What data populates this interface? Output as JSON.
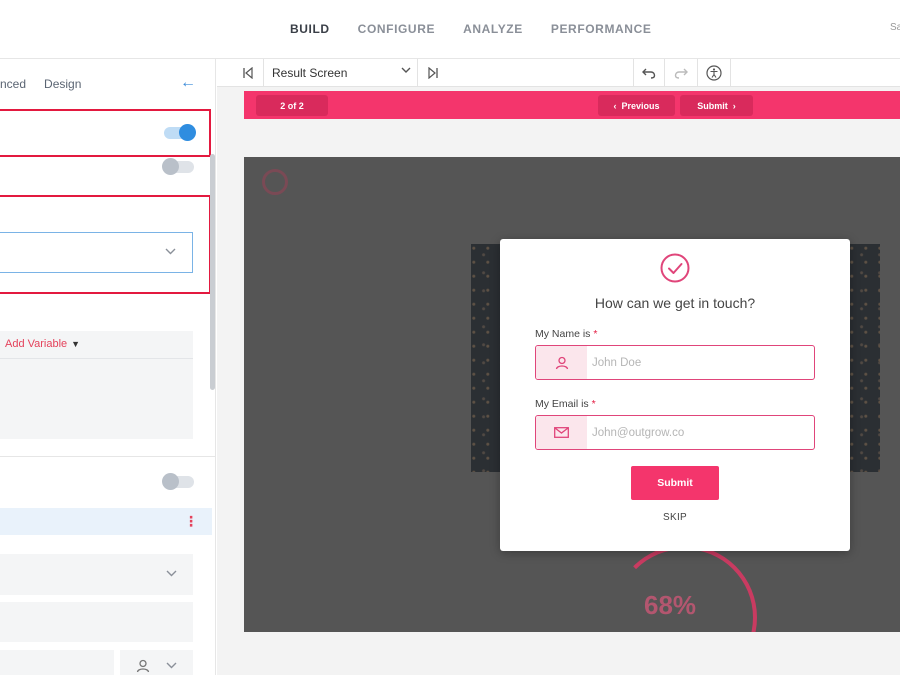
{
  "nav": {
    "tabs": [
      "BUILD",
      "CONFIGURE",
      "ANALYZE",
      "PERFORMANCE"
    ],
    "active": "BUILD",
    "right_text": "Sa"
  },
  "left_panel": {
    "tabs": [
      "nced",
      "Design"
    ],
    "add_variable": "Add Variable"
  },
  "toolbar": {
    "screen_select": "Result Screen"
  },
  "pink_bar": {
    "page_indicator": "2 of 2",
    "previous": "Previous",
    "submit": "Submit"
  },
  "preview": {
    "bg_percent": "68%"
  },
  "modal": {
    "title": "How can we get in touch?",
    "name_label": "My Name is",
    "name_placeholder": "John Doe",
    "email_label": "My Email is",
    "email_placeholder": "John@outgrow.co",
    "required_mark": "*",
    "submit": "Submit",
    "skip": "SKIP"
  },
  "colors": {
    "accent_pink": "#f4356c",
    "toggle_blue": "#2f8de0",
    "highlight_red": "#e3193f"
  }
}
